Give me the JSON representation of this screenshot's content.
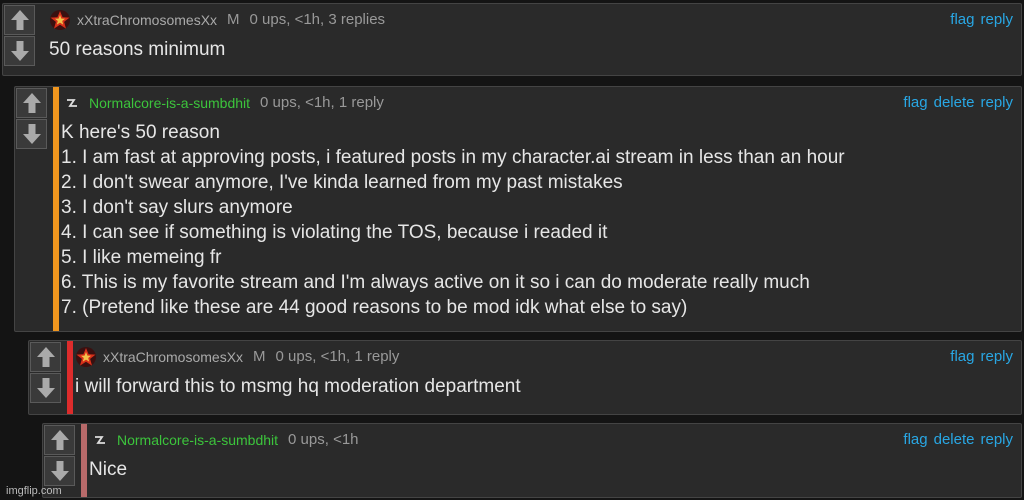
{
  "comments": [
    {
      "username": "xXtraChromosomesXx",
      "badge": "M",
      "meta": "0 ups, <1h, 3 replies",
      "actions": [
        "flag",
        "reply"
      ],
      "text": "50 reasons minimum",
      "bar_color": "#2a2a2a",
      "avatar": "star-avatar-icon"
    },
    {
      "username": "Normalcore-is-a-sumbdhit",
      "badge": "",
      "meta": "0 ups, <1h, 1 reply",
      "actions": [
        "flag",
        "delete",
        "reply"
      ],
      "text": "K here's 50 reason\n1. I am fast at approving posts, i featured posts in my character.ai stream in less than an hour\n2. I don't swear anymore, I've kinda learned from my past mistakes\n3. I don't say slurs anymore\n4. I can see if something is violating the TOS, because i readed it\n5. I like memeing fr\n6. This is my favorite stream and I'm always active on it so i can do moderate really much\n7. (Pretend like these are 44 good reasons to be mod idk what else to say)",
      "bar_color": "#f0961e",
      "avatar": "squiggle-avatar-icon"
    },
    {
      "username": "xXtraChromosomesXx",
      "badge": "M",
      "meta": "0 ups, <1h, 1 reply",
      "actions": [
        "flag",
        "reply"
      ],
      "text": "i will forward this to msmg hq moderation department",
      "bar_color": "#dd2c2c",
      "avatar": "star-avatar-icon"
    },
    {
      "username": "Normalcore-is-a-sumbdhit",
      "badge": "",
      "meta": "0 ups, <1h",
      "actions": [
        "flag",
        "delete",
        "reply"
      ],
      "text": "Nice",
      "bar_color": "#b86a6a",
      "avatar": "squiggle-avatar-icon"
    }
  ],
  "watermark": "imgflip.com",
  "colors": {
    "link": "#29a7e4",
    "username_green": "#3cc43c"
  }
}
